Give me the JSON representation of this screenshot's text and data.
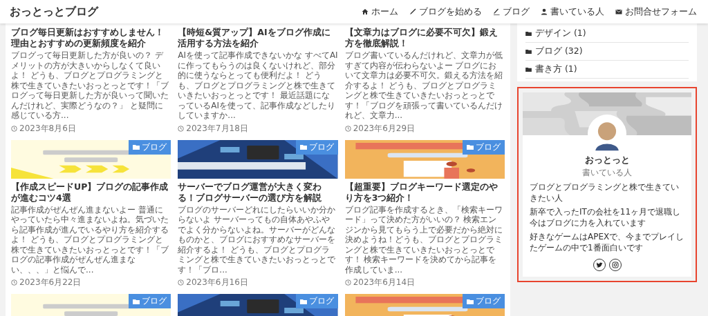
{
  "site": {
    "title": "おっとっとブログ"
  },
  "nav": [
    {
      "label": "ホーム"
    },
    {
      "label": "ブログを始める"
    },
    {
      "label": "ブログ"
    },
    {
      "label": "書いている人"
    },
    {
      "label": "お問合せフォーム"
    }
  ],
  "posts": [
    {
      "kind": "text",
      "title": "ブログ毎日更新はおすすめしません！理由とおすすめの更新頻度を紹介",
      "excerpt": "ブログって毎日更新した方が良いの？ デメリットの方が大きいからしなくて良いよ！ どうも、ブログとプログラミングと株で生きていきたいおっとっとです！「ブログって毎日更新した方が良いって聞いたんだけれど、実際どうなの？」 と疑問に感じている方...",
      "date": "2023年8月6日"
    },
    {
      "kind": "text",
      "title": "【時短&質アップ】AIをブログ作成に活用する方法を紹介",
      "excerpt": "AIを使って記事作成できないかな すべてAIに作ってもらうのは良くないけれど、部分的に使うならとっても便利だよ！ どうも、ブログとプログラミングと株で生きていきたいおっとっとです！ 最近話題になっているAIを使って、記事作成などしたりしていますか...",
      "date": "2023年7月18日"
    },
    {
      "kind": "text",
      "title": "【文章力はブログに必要不可欠】鍛え方を徹底解説！",
      "excerpt": "ブログ書いているんだけれど、文章力が低すぎて内容が伝わらないよー ブログにおいて文章力は必要不可欠。鍛える方法を紹介するよ！ どうも、ブログとプログラミングと株で生きていきたいおっとっとです！「ブログを頑張って書いているんだけれど、文章力...",
      "date": "2023年6月29日"
    },
    {
      "kind": "full",
      "category": "ブログ",
      "title": "【作成スピードUP】ブログの記事作成が進むコツ4選",
      "excerpt": "記事作成がぜんぜん進まないよー 普通にやっていたら中々進まないよね。気づいたら記事作成が進んでいるやり方を紹介するよ！ どうも、ブログとプログラミングと株で生きていきたいおっとっとです！「ブログの記事作成がぜんぜん進まない、、、」と悩んで...",
      "date": "2023年6月22日"
    },
    {
      "kind": "full",
      "category": "ブログ",
      "title": "サーバーでブログ運営が大きく変わる！ブログサーバーの選び方を解説",
      "excerpt": "ブログのサーバーどれにしたらいいか分からないよ サーバーってもの自体あやふやでよく分からないよね。サーバーがどんなものかと、ブログにおすすめなサーバーを紹介するよ！ どうも、ブログとプログラミングと株で生きていきたいおっとっとです！「ブロ...",
      "date": "2023年6月16日"
    },
    {
      "kind": "full",
      "category": "ブログ",
      "title": "【超重要】ブログキーワード選定のやり方を3つ紹介！",
      "excerpt": "ブログ記事を作成するとき、「検索キーワード」って決めた方がいいの？ 検索エンジンから見てもらう上で必要だから絶対に決めようね！どうも、ブログとプログラミングと株で生きていきたいおっとっとです！ 検索キーワードを決めてから記事を作成していま...",
      "date": "2023年6月14日"
    },
    {
      "kind": "thumb",
      "category": "ブログ"
    },
    {
      "kind": "thumb",
      "category": "ブログ"
    },
    {
      "kind": "thumb",
      "category": "ブログ"
    }
  ],
  "categories": [
    {
      "label": "デザイン",
      "count": "(1)"
    },
    {
      "label": "ブログ",
      "count": "(32)"
    },
    {
      "label": "書き方",
      "count": "(1)"
    }
  ],
  "profile": {
    "highlighted": true,
    "name": "おっとっと",
    "role": "書いている人",
    "bio": [
      "ブログとプログラミングと株で生きていきたい人",
      "新卒で入ったITの会社を11ヶ月で退職し今はブログに力を入れています",
      "好きなゲームはAPEXで、今までプレイしたゲームの中で1番面白いです"
    ],
    "social": [
      {
        "kind": "twitter"
      },
      {
        "kind": "instagram"
      }
    ]
  }
}
